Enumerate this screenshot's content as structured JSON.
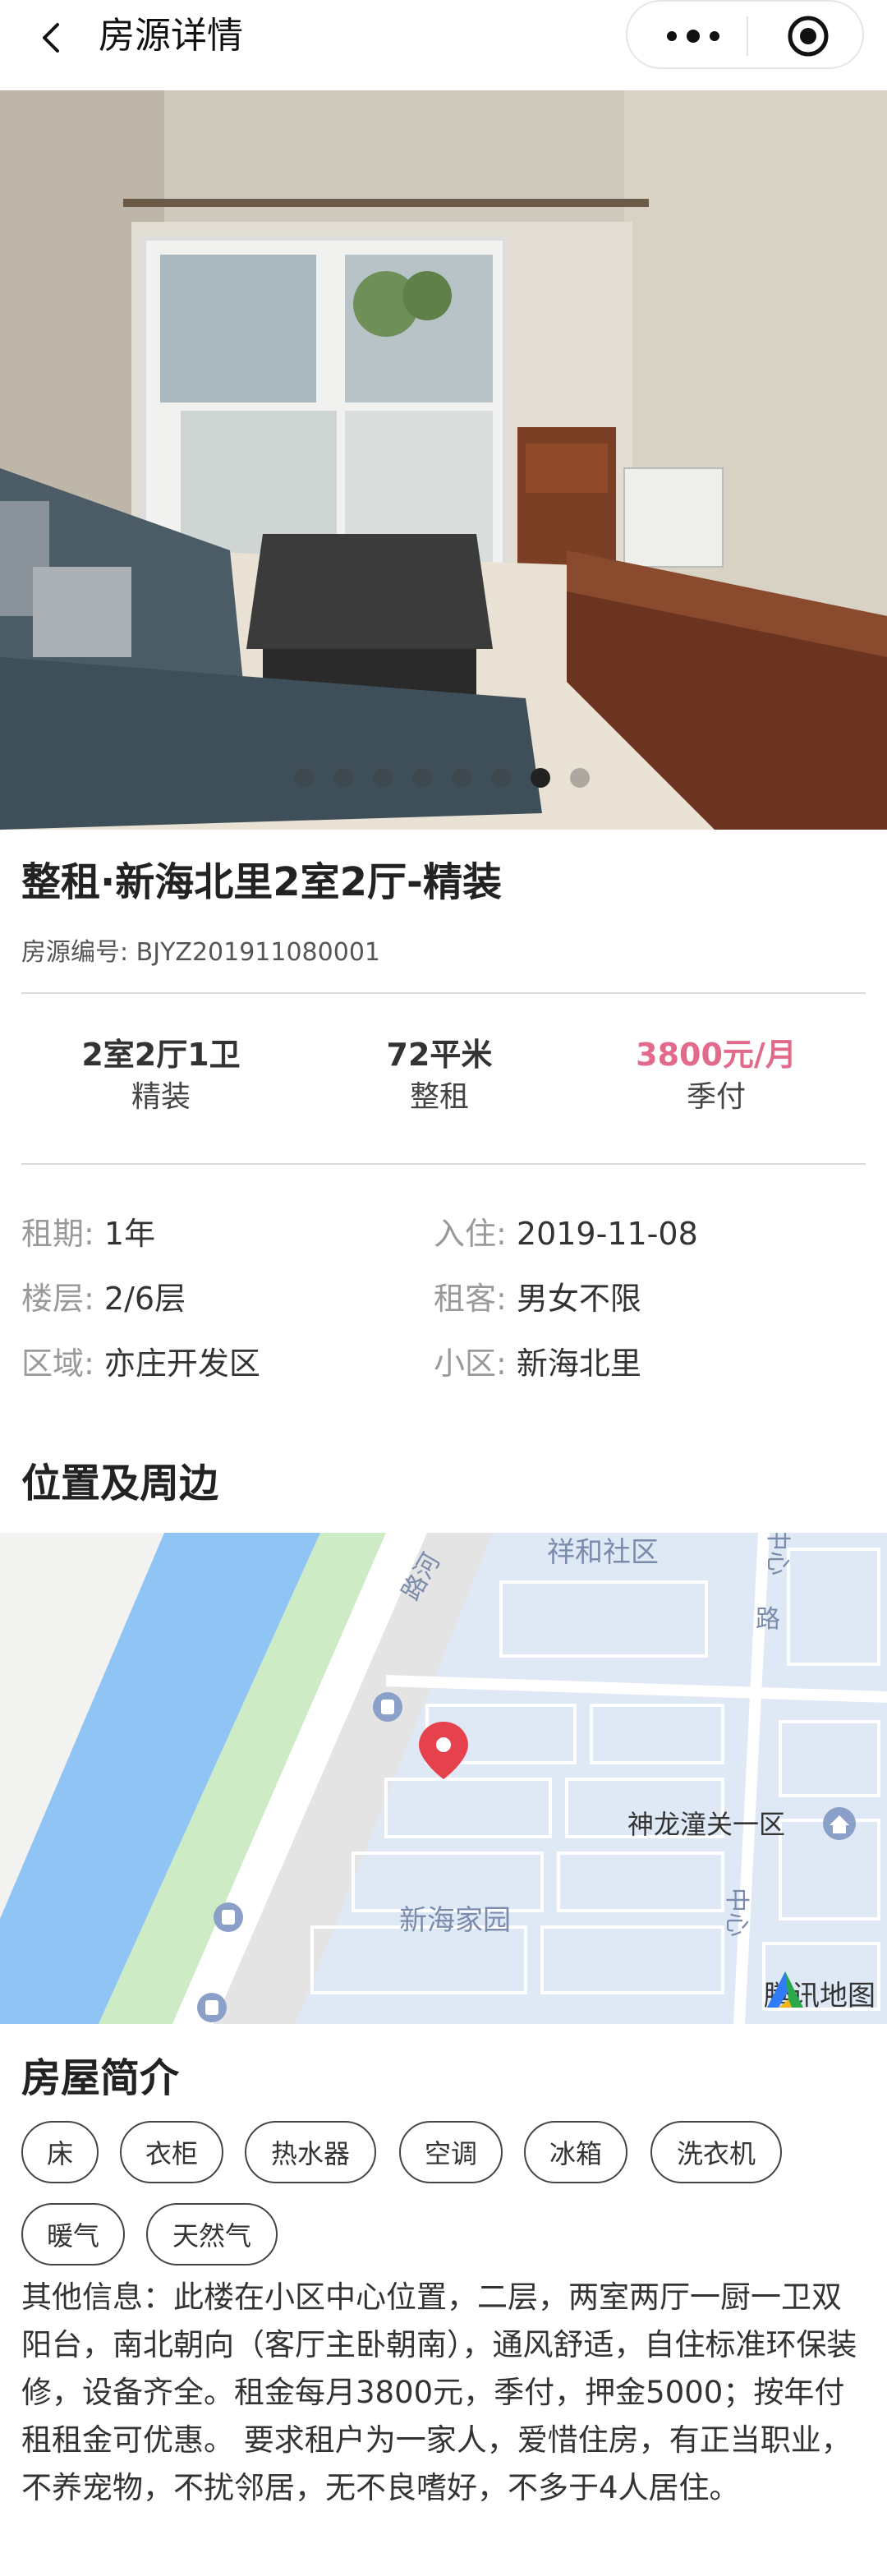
{
  "nav": {
    "title": "房源详情"
  },
  "gallery": {
    "dot_count": 8,
    "active_index": 6
  },
  "listing": {
    "title": "整租·新海北里2室2厅-精装",
    "code": "房源编号: BJYZ201911080001"
  },
  "stats": [
    {
      "value": "2室2厅1卫",
      "label": "精装"
    },
    {
      "value": "72平米",
      "label": "整租"
    },
    {
      "value": "3800元/月",
      "label": "季付"
    }
  ],
  "info": [
    {
      "key": "租期:",
      "value": "1年"
    },
    {
      "key": "入住:",
      "value": "2019-11-08"
    },
    {
      "key": "楼层:",
      "value": "2/6层"
    },
    {
      "key": "租客:",
      "value": "男女不限"
    },
    {
      "key": "区域:",
      "value": "亦庄开发区"
    },
    {
      "key": "小区:",
      "value": "新海北里"
    }
  ],
  "location": {
    "title": "位置及周边",
    "labels": {
      "xianghe": "祥和社区",
      "shenlong": "神龙潼关一区",
      "xinhai": "新海家园",
      "road1": "路河",
      "road2": "路",
      "road3": "中心",
      "road4": "中心"
    },
    "brand": "腾讯地图"
  },
  "intro": {
    "title": "房屋简介",
    "tags": [
      "床",
      "衣柜",
      "热水器",
      "空调",
      "冰箱",
      "洗衣机",
      "暖气",
      "天然气"
    ],
    "description": "其他信息：此楼在小区中心位置，二层，两室两厅一厨一卫双阳台，南北朝向（客厅主卧朝南），通风舒适，自住标准环保装修，设备齐全。租金每月3800元，季付，押金5000；按年付租租金可优惠。 要求租户为一家人，爱惜住房，有正当职业，不养宠物，不扰邻居，无不良嗜好，不多于4人居住。"
  },
  "colors": {
    "price": "#e26a8b",
    "map_water": "#8fc4f4",
    "map_green": "#cdebc4",
    "map_block": "#dfe8f5"
  }
}
